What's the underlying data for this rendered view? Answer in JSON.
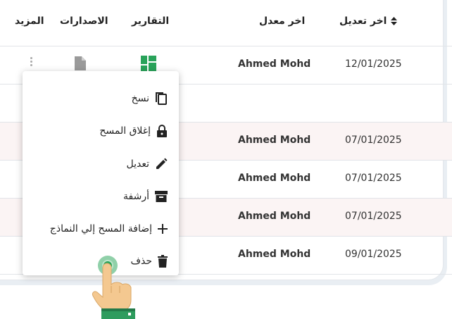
{
  "table": {
    "headers": {
      "more": "المزيد",
      "versions": "الاصدارات",
      "reports": "التقارير",
      "modified_by": "اخر معدل",
      "modified_at": "اخر تعديل"
    },
    "rows": [
      {
        "modified_by": "Ahmed Mohd",
        "modified_at": "12/01/2025"
      },
      {
        "modified_by": "",
        "modified_at": ""
      },
      {
        "modified_by": "Ahmed Mohd",
        "modified_at": "07/01/2025"
      },
      {
        "modified_by": "Ahmed Mohd",
        "modified_at": "07/01/2025"
      },
      {
        "modified_by": "Ahmed Mohd",
        "modified_at": "07/01/2025"
      },
      {
        "modified_by": "Ahmed Mohd",
        "modified_at": "09/01/2025"
      }
    ]
  },
  "context_menu": {
    "items": [
      {
        "label": "نسخ",
        "icon": "copy-icon"
      },
      {
        "label": "إغلاق المسح",
        "icon": "lock-icon"
      },
      {
        "label": "تعديل",
        "icon": "pencil-icon"
      },
      {
        "label": "أرشفة",
        "icon": "archive-icon"
      },
      {
        "label": "إضافة المسح إلي النماذج",
        "icon": "plus-icon"
      },
      {
        "label": "حذف",
        "icon": "trash-icon"
      }
    ]
  },
  "colors": {
    "accent_green": "#29a35a",
    "row_alt": "#fbf4f4",
    "hand_skin": "#f4c890",
    "sleeve": "#2e9c5e"
  }
}
